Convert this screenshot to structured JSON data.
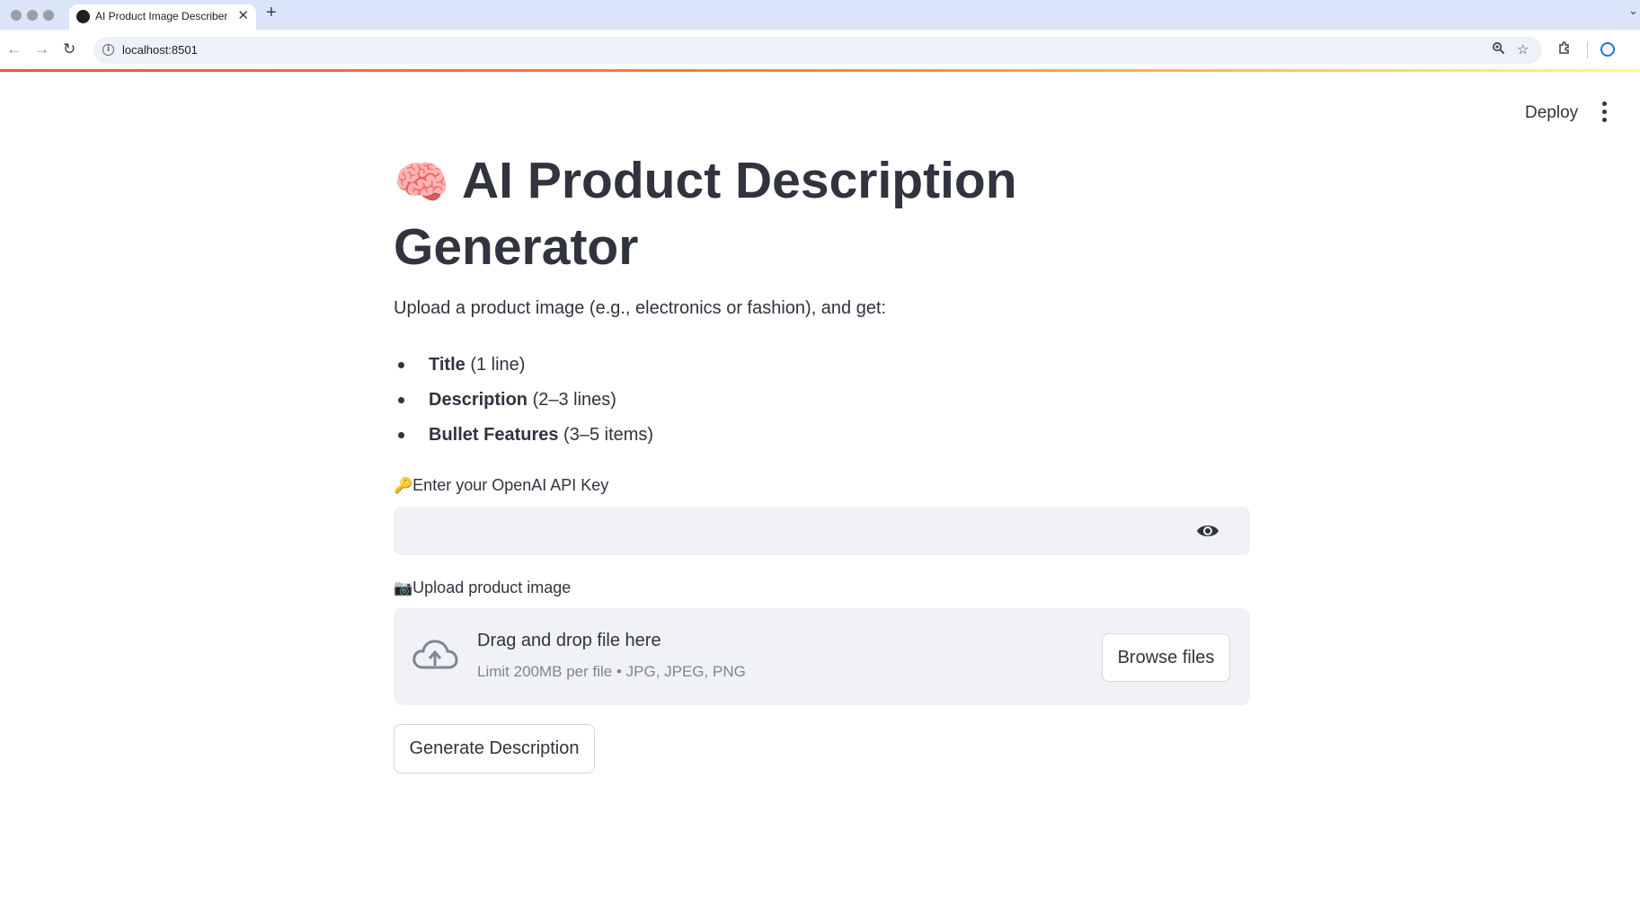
{
  "browser": {
    "tab_title": "AI Product Image Describer",
    "tab_close": "✕",
    "new_tab": "+",
    "url": "localhost:8501",
    "icons": [
      "back-icon",
      "forward-icon",
      "reload-icon",
      "site-info-icon",
      "zoom-icon",
      "bookmark-star-icon",
      "extensions-icon",
      "profile-icon",
      "browser-menu-icon"
    ]
  },
  "header": {
    "deploy_label": "Deploy"
  },
  "main": {
    "title_emoji": "🧠",
    "title_text": "AI Product Description Generator",
    "subtitle": "Upload a product image (e.g., electronics or fashion), and get:",
    "bullets": [
      {
        "bold": "Title",
        "rest": " (1 line)"
      },
      {
        "bold": "Description",
        "rest": " (2–3 lines)"
      },
      {
        "bold": "Bullet Features",
        "rest": " (3–5 items)"
      }
    ],
    "api_key_emoji": "🔑",
    "api_key_label": "Enter your OpenAI API Key",
    "api_key_value": "",
    "upload_emoji": "📷",
    "upload_label": "Upload product image",
    "dropzone_title": "Drag and drop file here",
    "dropzone_limit": "Limit 200MB per file • JPG, JPEG, PNG",
    "browse_label": "Browse files",
    "generate_label": "Generate Description"
  },
  "colors": {
    "text": "#31333f",
    "muted": "#808495",
    "input_bg": "#f0f2f6",
    "tabbar_bg": "#dbe5f9",
    "accent_gradient_start": "#ff4b4b",
    "accent_gradient_end": "#fffd80"
  }
}
